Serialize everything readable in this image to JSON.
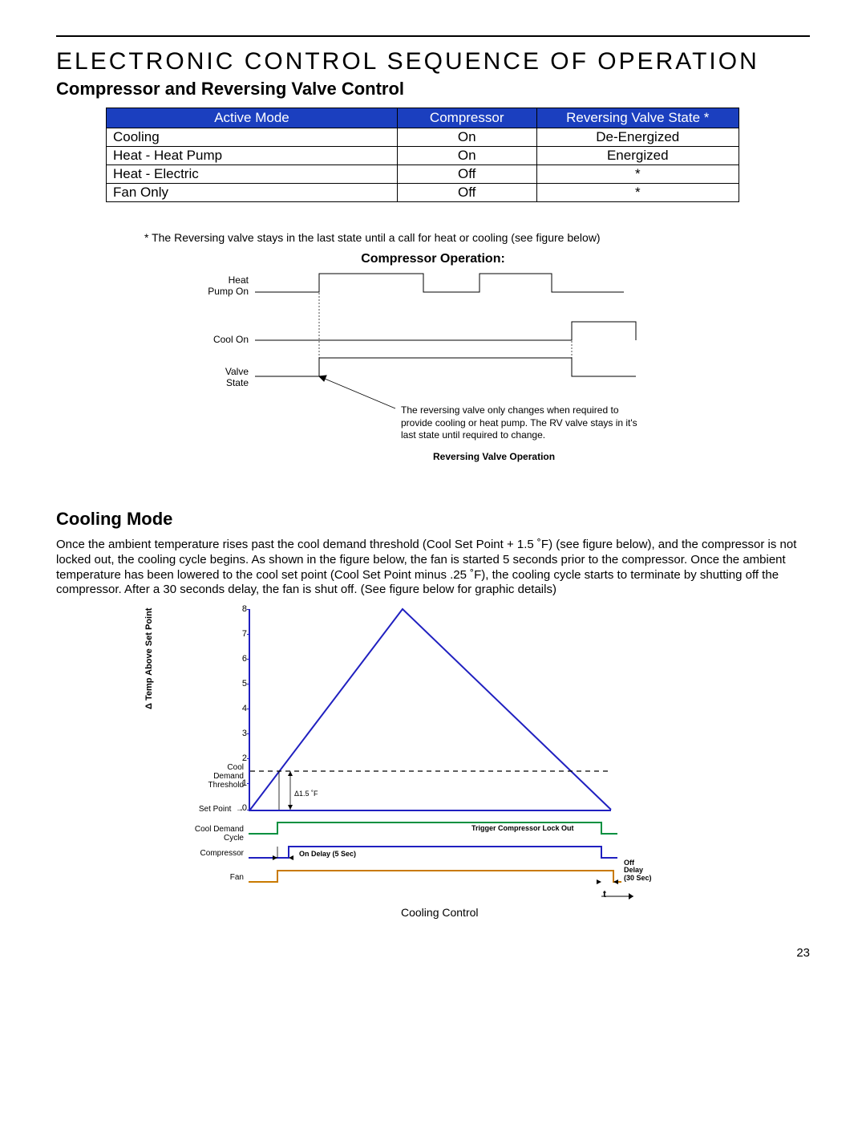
{
  "page_number": "23",
  "title": "ELECTRONIC CONTROL SEQUENCE OF OPERATION",
  "section1_title": "Compressor and Reversing Valve Control",
  "table": {
    "headers": [
      "Active Mode",
      "Compressor",
      "Reversing Valve State  *"
    ],
    "rows": [
      {
        "mode": "Cooling",
        "compressor": "On",
        "rv": "De-Energized"
      },
      {
        "mode": "Heat - Heat Pump",
        "compressor": "On",
        "rv": "Energized"
      },
      {
        "mode": "Heat - Electric",
        "compressor": "Off",
        "rv": "*"
      },
      {
        "mode": "Fan Only",
        "compressor": "Off",
        "rv": "*"
      }
    ]
  },
  "footnote": "* The Reversing valve stays in the last state until a call for heat or cooling (see figure below)",
  "fig1": {
    "title": "Compressor Operation:",
    "labels": {
      "hp": "Heat\nPump On",
      "cool": "Cool On",
      "valve": "Valve\nState"
    },
    "caption_text": "The reversing valve only changes when required to provide cooling or heat pump. The RV valve stays in it's last state until required to change.",
    "bottom_caption": "Reversing Valve Operation"
  },
  "section2_title": "Cooling Mode",
  "section2_body": "Once the ambient temperature rises past the cool demand threshold (Cool Set Point + 1.5 ˚F) (see figure below), and the compressor is not locked out, the cooling cycle begins. As shown in the figure below, the fan is started 5 seconds prior to the compressor. Once the ambient temperature has been lowered to the cool set point (Cool Set Point minus .25 ˚F), the cooling cycle starts to terminate by shutting off the compressor. After a 30 seconds delay, the fan is shut off. (See figure below for graphic details)",
  "fig2": {
    "yaxis_title": "Δ Temp Above Set Point",
    "y_ticks": [
      "0",
      "1",
      "2",
      "3",
      "4",
      "5",
      "6",
      "7",
      "8"
    ],
    "left_labels": {
      "cool_demand_threshold": "Cool\nDemand\nThreshold",
      "set_point": "Set Point",
      "cool_demand_cycle": "Cool Demand Cycle",
      "compressor": "Compressor",
      "fan": "Fan"
    },
    "annotations": {
      "delta_1_5": "Δ1.5 ˚F",
      "trigger": "Trigger Compressor Lock Out",
      "on_delay": "On Delay (5 Sec)",
      "off_delay": "Off\nDelay\n(30 Sec)",
      "t_arrow": "t"
    },
    "caption": "Cooling Control"
  },
  "chart_data": [
    {
      "type": "line",
      "title": "Compressor Operation / Reversing Valve Operation",
      "x": [
        0,
        1,
        2,
        3,
        4,
        5,
        6,
        7,
        8,
        9,
        10
      ],
      "series": [
        {
          "name": "Heat Pump On",
          "values": [
            0,
            0,
            1,
            1,
            1,
            0,
            0,
            1,
            1,
            0,
            0
          ]
        },
        {
          "name": "Cool On",
          "values": [
            0,
            0,
            0,
            0,
            0,
            0,
            0,
            0,
            0,
            1,
            1
          ]
        },
        {
          "name": "Valve State",
          "values": [
            0,
            0,
            1,
            1,
            1,
            1,
            1,
            1,
            1,
            0,
            0
          ]
        }
      ],
      "xlabel": "",
      "ylabel": "",
      "ylim": [
        0,
        1
      ]
    },
    {
      "type": "line",
      "title": "Cooling Control",
      "ylabel": "Δ Temp Above Set Point",
      "x": [
        0,
        1,
        2,
        3,
        4,
        5,
        6,
        7,
        8,
        9,
        10,
        11,
        12,
        13,
        14,
        15,
        16
      ],
      "series": [
        {
          "name": "Temperature",
          "values": [
            0,
            1,
            2,
            3,
            4,
            5,
            6,
            7,
            8,
            7,
            6,
            5,
            4,
            3,
            2,
            1,
            0
          ]
        },
        {
          "name": "Cool Demand Threshold",
          "values": [
            1.5,
            1.5,
            1.5,
            1.5,
            1.5,
            1.5,
            1.5,
            1.5,
            1.5,
            1.5,
            1.5,
            1.5,
            1.5,
            1.5,
            1.5,
            1.5,
            1.5
          ]
        },
        {
          "name": "Cool Demand Cycle",
          "values": [
            0,
            0,
            1,
            1,
            1,
            1,
            1,
            1,
            1,
            1,
            1,
            1,
            1,
            1,
            1,
            1,
            0
          ]
        },
        {
          "name": "Compressor",
          "values": [
            0,
            0,
            1,
            1,
            1,
            1,
            1,
            1,
            1,
            1,
            1,
            1,
            1,
            1,
            1,
            1,
            0
          ]
        },
        {
          "name": "Fan",
          "values": [
            0,
            0,
            1,
            1,
            1,
            1,
            1,
            1,
            1,
            1,
            1,
            1,
            1,
            1,
            1,
            1,
            1
          ]
        }
      ],
      "ylim": [
        0,
        8
      ],
      "annotations": [
        "Δ1.5 ˚F",
        "Trigger Compressor Lock Out",
        "On Delay (5 Sec)",
        "Off Delay (30 Sec)"
      ]
    }
  ]
}
